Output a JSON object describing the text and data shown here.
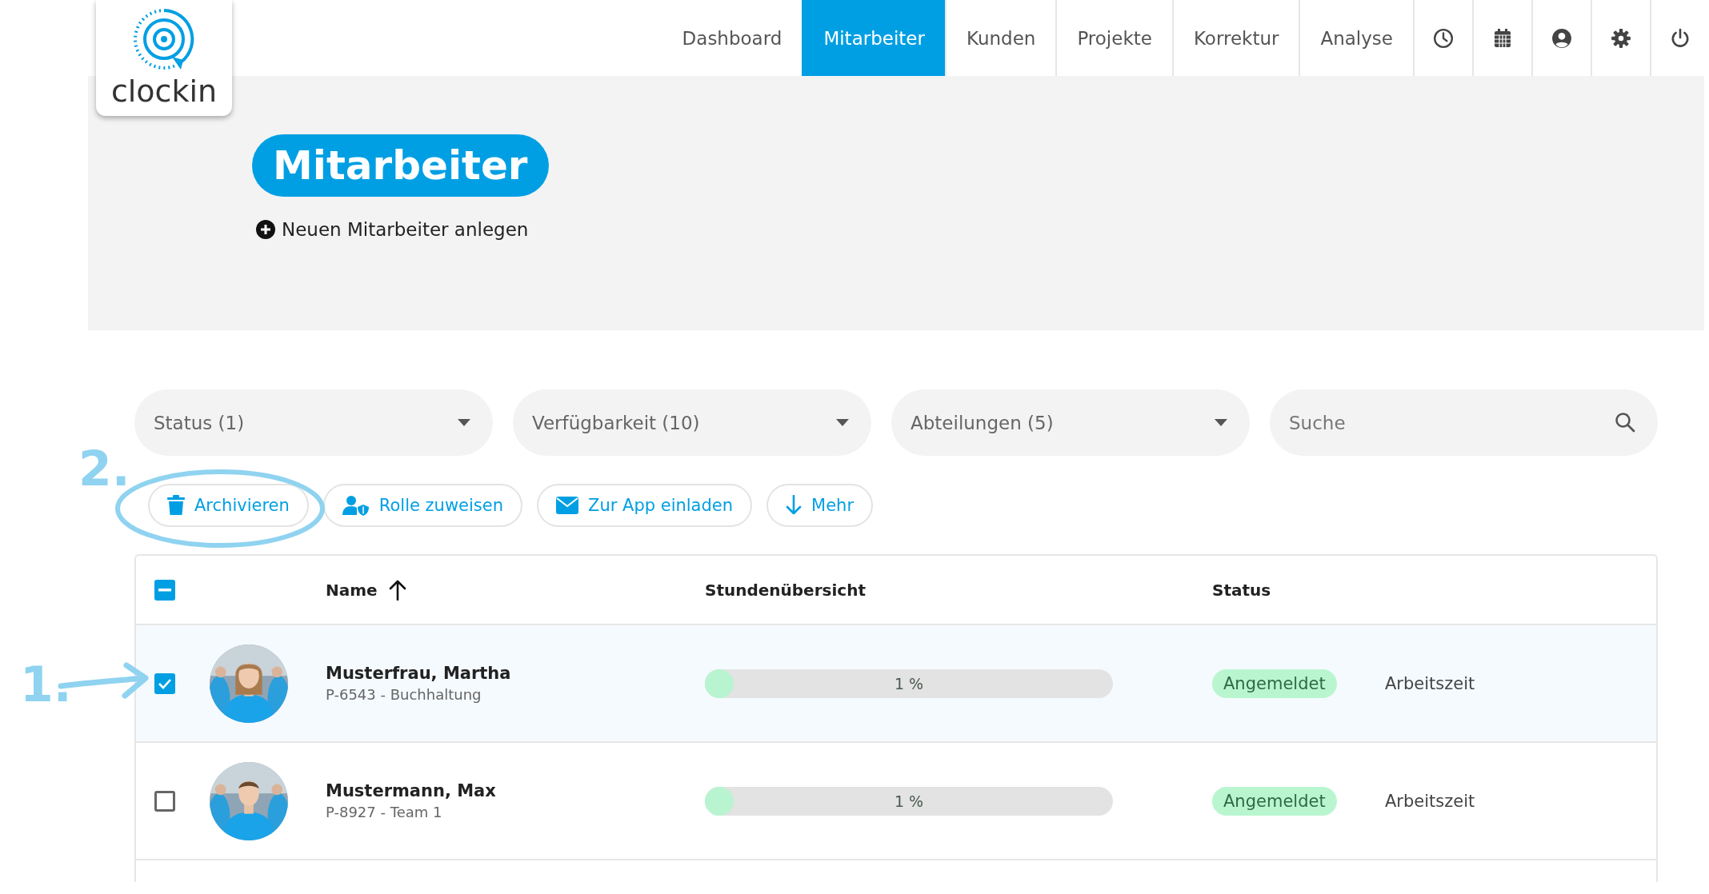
{
  "logo": {
    "text": "clockin"
  },
  "nav": {
    "items": [
      {
        "label": "Dashboard",
        "selected": false
      },
      {
        "label": "Mitarbeiter",
        "selected": true
      },
      {
        "label": "Kunden",
        "selected": false
      },
      {
        "label": "Projekte",
        "selected": false
      },
      {
        "label": "Korrektur",
        "selected": false
      },
      {
        "label": "Analyse",
        "selected": false
      }
    ]
  },
  "page_title": "Mitarbeiter",
  "add_link": "Neuen Mitarbeiter anlegen",
  "filters": [
    {
      "kind": "dropdown",
      "label": "Status (1)"
    },
    {
      "kind": "dropdown",
      "label": "Verfügbarkeit (10)"
    },
    {
      "kind": "dropdown",
      "label": "Abteilungen (5)"
    },
    {
      "kind": "search",
      "placeholder": "Suche"
    }
  ],
  "actions": [
    {
      "kind": "trash",
      "label": "Archivieren"
    },
    {
      "kind": "role",
      "label": "Rolle zuweisen"
    },
    {
      "kind": "mail",
      "label": "Zur App einladen"
    },
    {
      "kind": "download",
      "label": "Mehr"
    }
  ],
  "table": {
    "select_all": {
      "indeterminate": true
    },
    "columns": [
      {
        "label": "Name",
        "sorted": true
      },
      {
        "label": "Stundenübersicht"
      },
      {
        "label": "Status"
      }
    ],
    "rows": [
      {
        "checked": true,
        "name": "Musterfrau, Martha",
        "detail": "P-6543 - Buchhaltung",
        "level": 0.01,
        "reading": "1 %",
        "status": "Angemeldet",
        "column_5": "Arbeitszeit"
      },
      {
        "checked": false,
        "name": "Mustermann, Max",
        "detail": "P-8927 - Team 1",
        "level": 0.01,
        "reading": "1 %",
        "status": "Angemeldet",
        "column_5": "Arbeitszeit"
      }
    ]
  },
  "annotations": [
    {
      "kind": "ellipse",
      "label": "2."
    },
    {
      "kind": "arrow",
      "label": "1."
    }
  ]
}
